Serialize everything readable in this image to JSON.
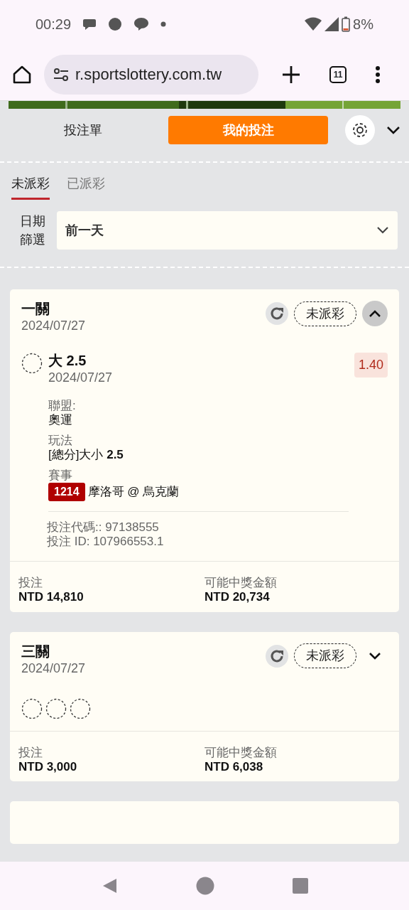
{
  "status_bar": {
    "time": "00:29",
    "battery": "8%"
  },
  "browser": {
    "url": "r.sportslottery.com.tw",
    "tab_count": "11"
  },
  "header_tabs": [
    {
      "label": "投注單",
      "selected": false
    },
    {
      "label": "我的投注",
      "selected": true
    }
  ],
  "filter_tabs": [
    {
      "label": "未派彩",
      "selected": true
    },
    {
      "label": "已派彩",
      "selected": false
    }
  ],
  "date_filter": {
    "label": "日期篩選",
    "value": "前一天"
  },
  "bets": [
    {
      "title": "一關",
      "date": "2024/07/27",
      "status": "未派彩",
      "expanded": true,
      "selections": [
        {
          "pick": "大 2.5",
          "date": "2024/07/27",
          "odds": "1.40",
          "league_label": "聯盟:",
          "league": "奧運",
          "market_label": "玩法",
          "market": "[總分]大小 **2.5**",
          "event_label": "賽事",
          "event_code": "1214",
          "event": "摩洛哥 @ 烏克蘭"
        }
      ],
      "code_line": "投注代碼:: 97138555",
      "id_line": "投注 ID: 107966553.1",
      "stake_label": "投注",
      "stake": "NTD 14,810",
      "payout_label": "可能中獎金額",
      "payout": "NTD 20,734"
    },
    {
      "title": "三關",
      "date": "2024/07/27",
      "status": "未派彩",
      "expanded": false,
      "legs": [
        {
          "kind": "pending"
        },
        {
          "kind": "pending"
        },
        {
          "kind": "pending"
        }
      ],
      "stake_label": "投注",
      "stake": "NTD 3,000",
      "payout_label": "可能中獎金額",
      "payout": "NTD 6,038"
    }
  ]
}
